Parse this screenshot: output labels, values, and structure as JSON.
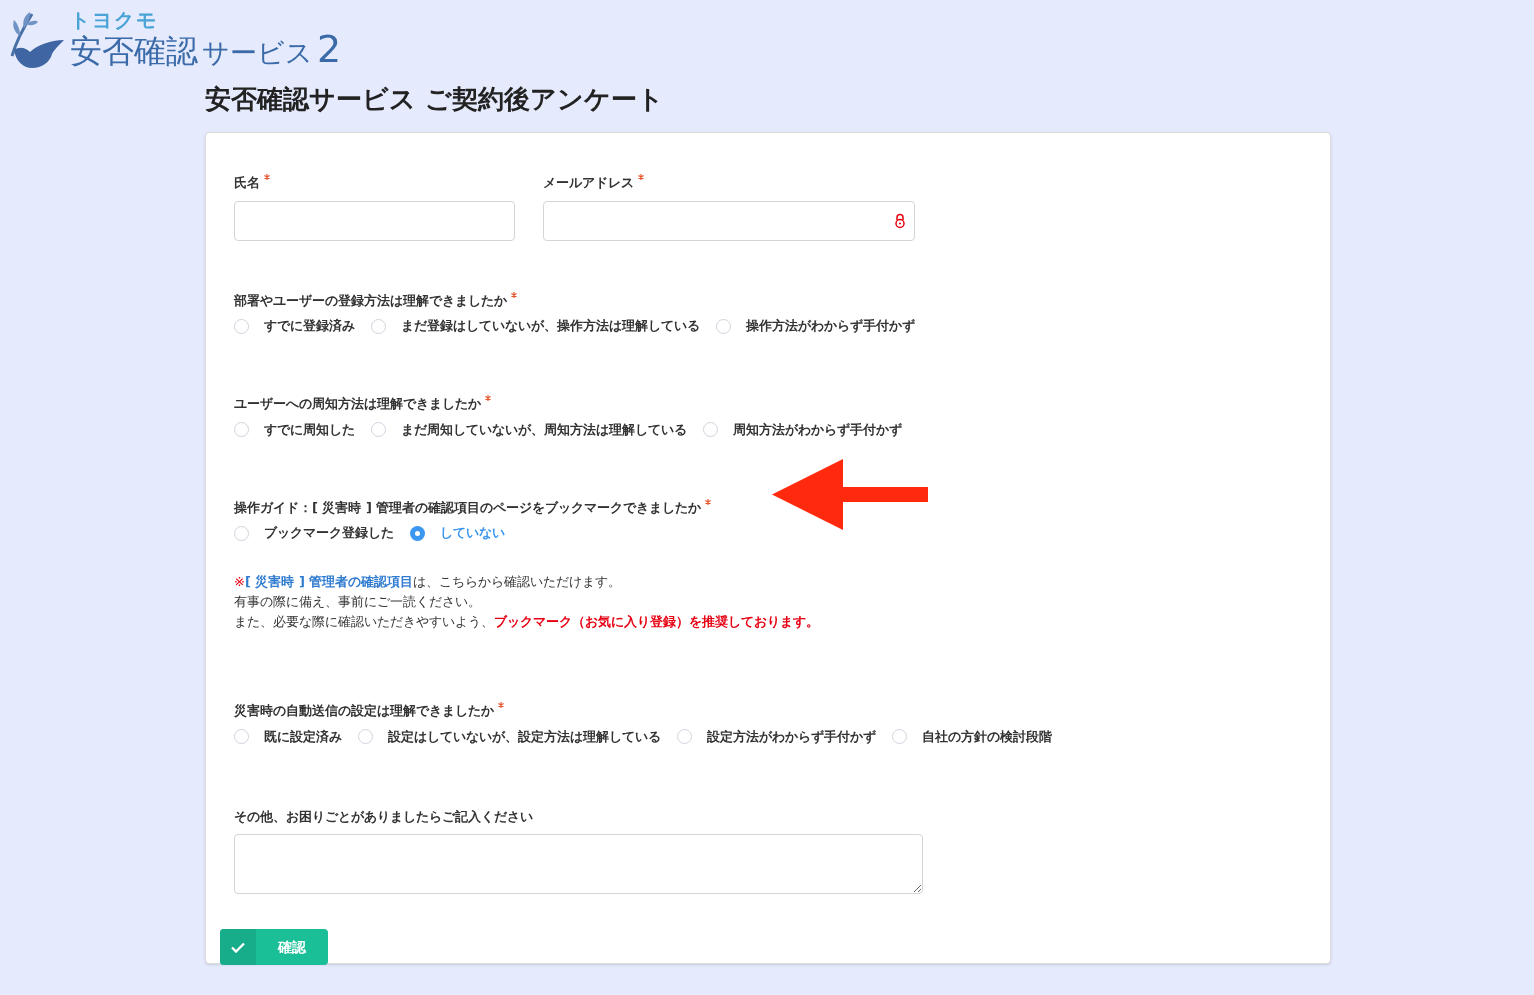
{
  "logo": {
    "brand": "トヨクモ",
    "product": "安否確認",
    "product_sub": "サービス",
    "version": "2"
  },
  "title": "安否確認サービス ご契約後アンケート",
  "fields": [
    {
      "label": "氏名",
      "required": true,
      "kind": "text"
    },
    {
      "label": "メールアドレス",
      "required": true,
      "kind": "email"
    }
  ],
  "questions": [
    {
      "label": "部署やユーザーの登録方法は理解できましたか",
      "required": true,
      "options": [
        {
          "label": "すでに登録済み",
          "selected": false
        },
        {
          "label": "まだ登録はしていないが、操作方法は理解している",
          "selected": false
        },
        {
          "label": "操作方法がわからず手付かず",
          "selected": false
        }
      ]
    },
    {
      "label": "ユーザーへの周知方法は理解できましたか",
      "required": true,
      "options": [
        {
          "label": "すでに周知した",
          "selected": false
        },
        {
          "label": "まだ周知していないが、周知方法は理解している",
          "selected": false
        },
        {
          "label": "周知方法がわからず手付かず",
          "selected": false
        }
      ]
    },
    {
      "label": "操作ガイド：[ 災害時 ] 管理者の確認項目のページをブックマークできましたか",
      "required": true,
      "options": [
        {
          "label": "ブックマーク登録した",
          "selected": false
        },
        {
          "label": "していない",
          "selected": true
        }
      ],
      "note": [
        [
          {
            "kind": "mark",
            "text": "※"
          },
          {
            "kind": "link",
            "text": "[ 災害時 ] 管理者の確認項目"
          },
          {
            "kind": "plain",
            "text": "は、こちらから確認いただけます。"
          }
        ],
        [
          {
            "kind": "plain",
            "text": "有事の際に備え、事前にご一読ください。"
          }
        ],
        [
          {
            "kind": "plain",
            "text": "また、必要な際に確認いただきやすいよう、"
          },
          {
            "kind": "emphasis",
            "text": "ブックマーク（お気に入り登録）を推奨しております。"
          }
        ]
      ]
    },
    {
      "label": "災害時の自動送信の設定は理解できましたか",
      "required": true,
      "options": [
        {
          "label": "既に設定済み",
          "selected": false
        },
        {
          "label": "設定はしていないが、設定方法は理解している",
          "selected": false
        },
        {
          "label": "設定方法がわからず手付かず",
          "selected": false
        },
        {
          "label": "自社の方針の検討段階",
          "selected": false
        }
      ]
    }
  ],
  "comment": {
    "label": "その他、お困りごとがありましたらご記入ください"
  },
  "submit": "確認"
}
